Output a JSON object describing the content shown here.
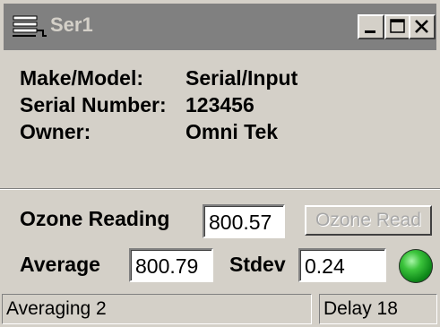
{
  "window": {
    "title": "Ser1"
  },
  "info": {
    "make_model_label": "Make/Model:",
    "make_model_value": "Serial/Input",
    "serial_number_label": "Serial Number:",
    "serial_number_value": "123456",
    "owner_label": "Owner:",
    "owner_value": "Omni Tek"
  },
  "readings": {
    "ozone_label": "Ozone Reading",
    "ozone_value": "800.57",
    "ozone_button_label": "Ozone Read",
    "average_label": "Average",
    "average_value": "800.79",
    "stdev_label": "Stdev",
    "stdev_value": "0.24"
  },
  "status": {
    "left": "Averaging 2",
    "right": "Delay 18"
  },
  "colors": {
    "titlebar": "#808080",
    "face": "#d4d0c8",
    "indicator": "#22b022"
  }
}
